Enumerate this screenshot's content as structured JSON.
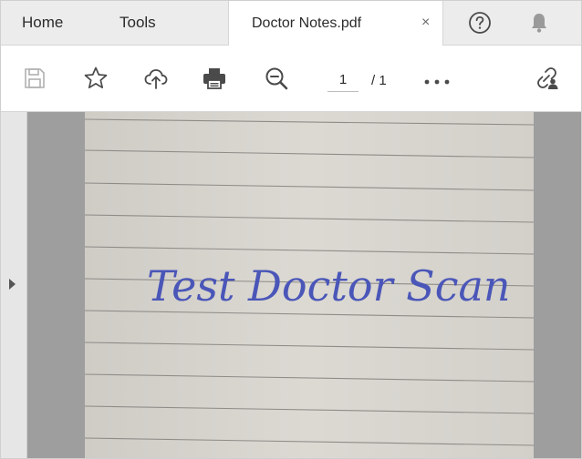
{
  "tabs": {
    "home": "Home",
    "tools": "Tools"
  },
  "document_tab": {
    "title": "Doctor Notes.pdf",
    "close": "×"
  },
  "pagination": {
    "current": "1",
    "separator_total": "/ 1"
  },
  "handwriting": "Test Doctor Scan",
  "icons": {
    "save": "save-icon",
    "bookmark": "star-icon",
    "upload": "cloud-upload-icon",
    "print": "printer-icon",
    "zoom": "zoom-out-icon",
    "more": "more-icon",
    "share": "share-link-icon",
    "help": "help-icon",
    "notifications": "bell-icon"
  },
  "colors": {
    "ink": "#4a56b8",
    "viewer_bg": "#9e9e9e",
    "page_bg": "#d9d6d0"
  }
}
